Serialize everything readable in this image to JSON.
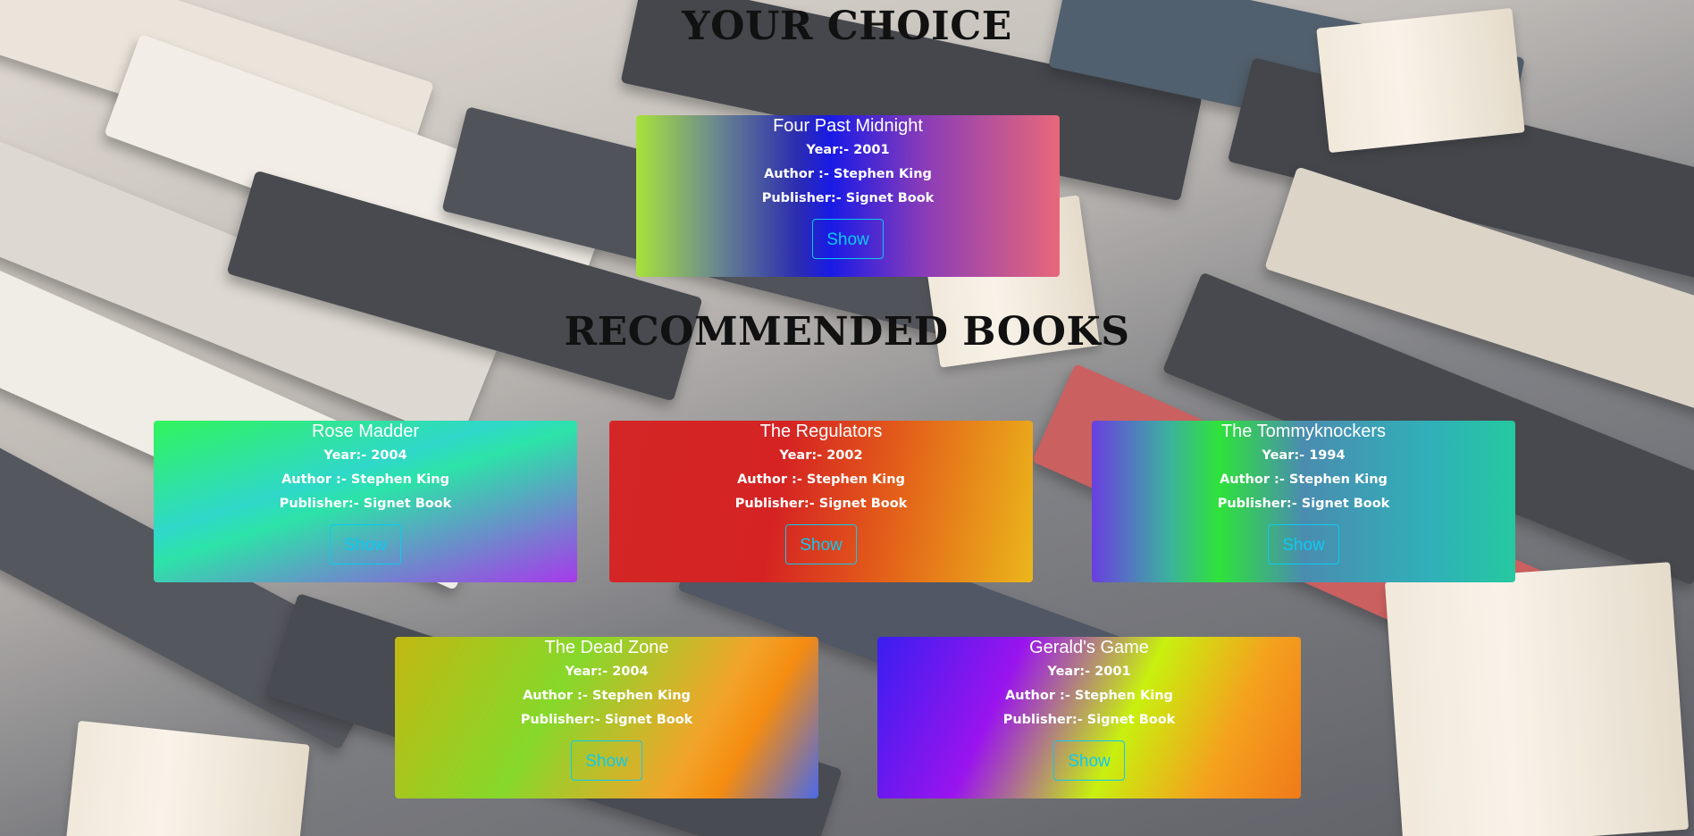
{
  "headings": {
    "your_choice": "YOUR CHOICE",
    "recommended": "RECOMMENDED BOOKS"
  },
  "labels": {
    "year_prefix": "Year:-",
    "author_prefix": "Author :-",
    "publisher_prefix": "Publisher:-"
  },
  "choice": {
    "title": "Four Past Midnight",
    "year": "Year:- 2001",
    "author": "Author :- Stephen King",
    "publisher": "Publisher:- Signet Book",
    "button": "Show"
  },
  "recommended": [
    {
      "title": "Rose Madder",
      "year": "Year:- 2004",
      "author": "Author :- Stephen King",
      "publisher": "Publisher:- Signet Book",
      "button": "Show"
    },
    {
      "title": "The Regulators",
      "year": "Year:- 2002",
      "author": "Author :- Stephen King",
      "publisher": "Publisher:- Signet Book",
      "button": "Show"
    },
    {
      "title": "The Tommyknockers",
      "year": "Year:- 1994",
      "author": "Author :- Stephen King",
      "publisher": "Publisher:- Signet Book",
      "button": "Show"
    },
    {
      "title": "The Dead Zone",
      "year": "Year:- 2004",
      "author": "Author :- Stephen King",
      "publisher": "Publisher:- Signet Book",
      "button": "Show"
    },
    {
      "title": "Gerald's Game",
      "year": "Year:- 2001",
      "author": "Author :- Stephen King",
      "publisher": "Publisher:- Signet Book",
      "button": "Show"
    }
  ],
  "colors": {
    "button_accent": "#0dcaf0",
    "heading_text": "#111111",
    "card_text": "#ffffff"
  }
}
